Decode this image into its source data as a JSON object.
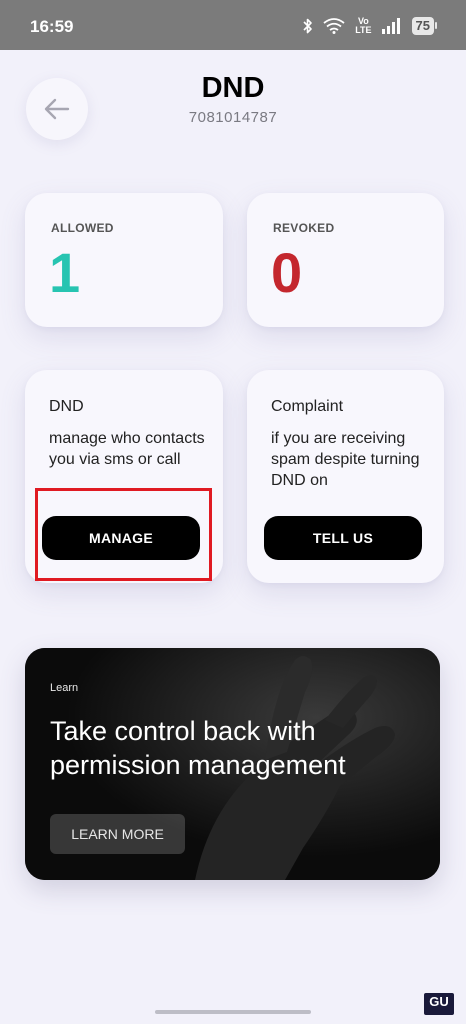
{
  "status_bar": {
    "time": "16:59",
    "volte": [
      "Vo",
      "LTE"
    ],
    "battery": "75"
  },
  "header": {
    "title": "DND",
    "subtitle": "7081014787"
  },
  "stats": {
    "allowed": {
      "label": "ALLOWED",
      "count": "1"
    },
    "revoked": {
      "label": "REVOKED",
      "count": "0"
    }
  },
  "features": {
    "dnd": {
      "title": "DND",
      "description": "manage who contacts you via sms or call",
      "button": "MANAGE"
    },
    "complaint": {
      "title": "Complaint",
      "description": "if you are receiving spam despite turning DND on",
      "button": "TELL US"
    }
  },
  "learn": {
    "kicker": "Learn",
    "headline": "Take control back with permission management",
    "button": "LEARN MORE"
  },
  "colors": {
    "allowed": "#27c4b1",
    "revoked": "#c4272e",
    "highlight": "#e01a22",
    "background": "#f2f1fa"
  },
  "watermark": {
    "text": "GU"
  }
}
